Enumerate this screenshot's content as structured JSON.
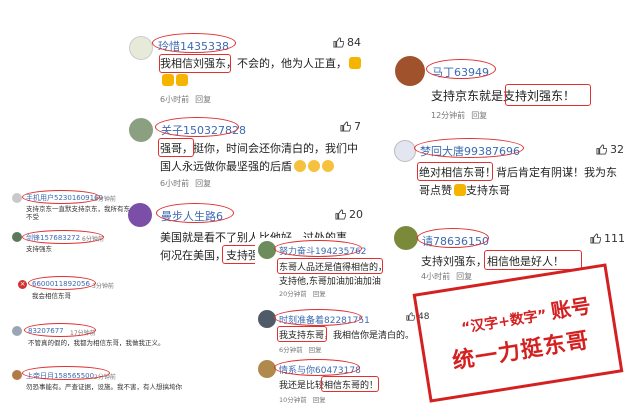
{
  "left_comments": [
    {
      "username": "玲惜1435338",
      "likes": "84",
      "text_lines": [
        "我相信刘强东，不会的，他为人正直，",
        ""
      ],
      "time": "6小时前",
      "reply": "回复"
    },
    {
      "username": "关子150327828",
      "likes": "7",
      "text_lines": [
        "强哥，挺你，时间会还你清白的，我们中",
        "国人永远做你最坚强的后盾"
      ],
      "time": "6小时前",
      "reply": "回复"
    },
    {
      "username": "曼步人生路6",
      "likes": "20",
      "text_lines": [
        "美国就是看不了别人比他好，过处的事",
        "何况在美国，支持强"
      ],
      "time": "",
      "reply": ""
    }
  ],
  "right_comments": [
    {
      "username": "马丁63949",
      "likes": "",
      "text_lines": [
        "支持京东就是支持刘强东！"
      ],
      "time": "12分钟前",
      "reply": "回复"
    },
    {
      "username": "梦回大唐99387696",
      "likes": "32",
      "text_lines": [
        "绝对相信东哥！背后肯定有阴谋！我为东",
        "哥点赞",
        "支持东哥"
      ],
      "time": "",
      "reply": ""
    },
    {
      "username": "请78636150",
      "likes": "111",
      "text_lines": [
        "支持刘强东，相信他是好人！"
      ],
      "time": "4小时前",
      "reply": "回复"
    }
  ],
  "mini_left": [
    {
      "username": "手机用户52301609169",
      "time": "3分钟前",
      "text": [
        "支持京东一直默支持京东，我所有东",
        "不受"
      ]
    },
    {
      "username": "剑锋157683272",
      "time": "6分钟前",
      "text": [
        "支持强东"
      ]
    },
    {
      "username": "6600011892056",
      "time": "3分钟前",
      "text": [
        "我会相信东哥"
      ]
    },
    {
      "username": "83207677",
      "time": "17分钟前",
      "text": [
        "不管真的假的，我都为相信东哥，我做我正义。"
      ]
    },
    {
      "username": "上帝日月158565500",
      "time": "2分钟前",
      "text": [
        "勿恐事能有。严查证据，设施。我不害，有人想搞垮你"
      ]
    }
  ],
  "mini_mid": [
    {
      "username": "努力奋斗194235762",
      "text": [
        "东哥人品还是值得相信的，",
        "支持他,东哥加油加油加油"
      ],
      "time": "20分钟前",
      "reply": "回复"
    },
    {
      "username": "时刻准备着82281751",
      "text": [
        "我支持东哥，我相信你是清白的。"
      ],
      "time": "6分钟前",
      "reply": "回复"
    },
    {
      "username": "情系与你60473178",
      "text": [
        "我还是比较相信东哥的！"
      ],
      "time": "10分钟前",
      "reply": "回复"
    }
  ],
  "footer_like": "48",
  "stamp": {
    "line1_a": "“汉字+数字”",
    "line1_b": "账号",
    "line2": "统一力挺东哥"
  },
  "colors": {
    "username": "#3b6bb1",
    "annotation": "#e03030",
    "stamp": "#d42020"
  }
}
